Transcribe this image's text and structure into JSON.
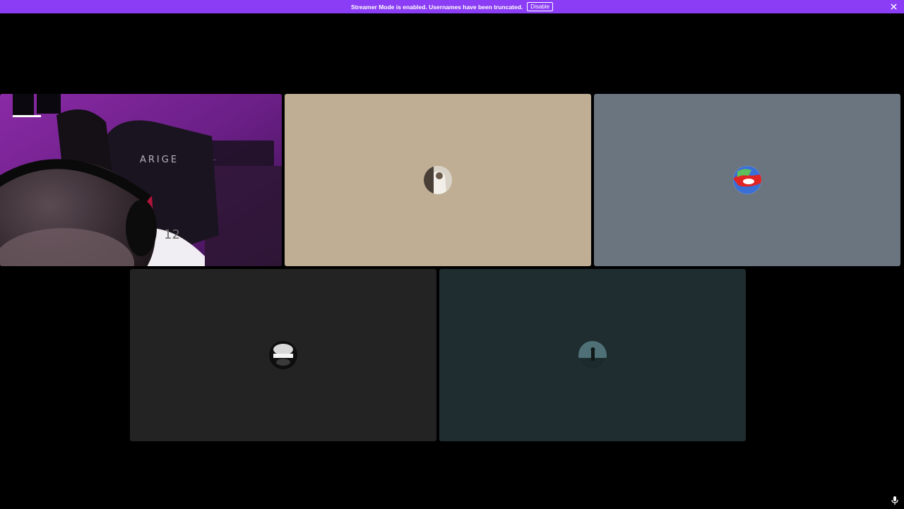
{
  "banner": {
    "message": "Streamer Mode is enabled. Usernames have been truncated.",
    "disable_label": "Disable",
    "close_icon": "close-icon",
    "color": "#8b3df5"
  },
  "tiles": [
    {
      "id": "camera",
      "type": "video",
      "background": "#5a1a6b"
    },
    {
      "id": "user-2",
      "type": "avatar",
      "background": "#bfae94"
    },
    {
      "id": "user-3",
      "type": "avatar",
      "background": "#6b7580"
    },
    {
      "id": "user-4",
      "type": "avatar",
      "background": "#232323"
    },
    {
      "id": "user-5",
      "type": "avatar",
      "background": "#1f2d31"
    }
  ],
  "camera_text": {
    "chair_brand": "ARIGE",
    "sign_line_1": "...",
    "jersey_number": "12"
  },
  "mic_icon": "microphone-icon"
}
